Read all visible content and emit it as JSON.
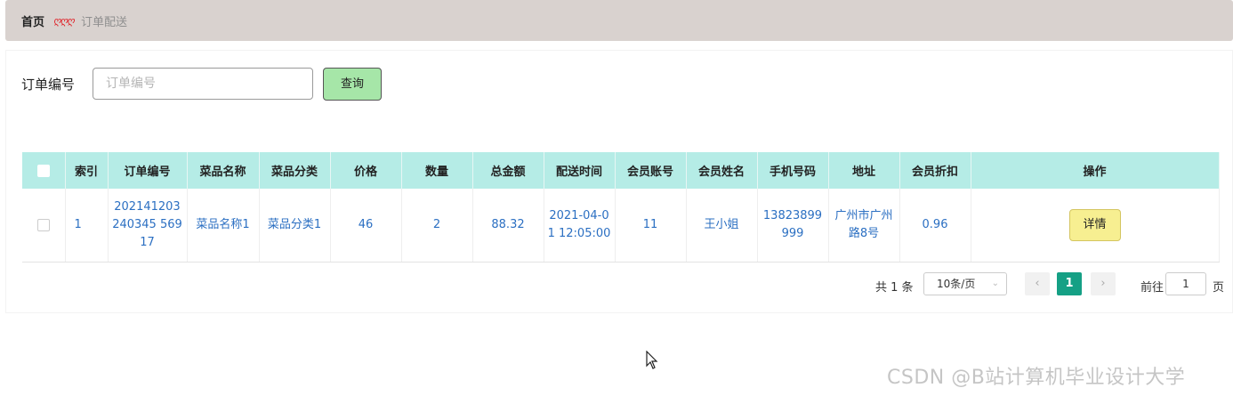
{
  "breadcrumb": {
    "home": "首页",
    "separator": "ღღღ",
    "current": "订单配送"
  },
  "search": {
    "label": "订单编号",
    "placeholder": "订单编号",
    "value": "",
    "button": "查询"
  },
  "table": {
    "headers": [
      "",
      "索引",
      "订单编号",
      "菜品名称",
      "菜品分类",
      "价格",
      "数量",
      "总金额",
      "配送时间",
      "会员账号",
      "会员姓名",
      "手机号码",
      "地址",
      "会员折扣",
      "操作"
    ],
    "rows": [
      {
        "index": "1",
        "order_no": "202141203240345 56917",
        "dish_name": "菜品名称1",
        "dish_category": "菜品分类1",
        "price": "46",
        "quantity": "2",
        "total": "88.32",
        "delivery_time": "2021-04-01 12:05:00",
        "member_account": "11",
        "member_name": "王小姐",
        "phone": "13823899999",
        "address": "广州市广州路8号",
        "discount": "0.96",
        "action": "详情"
      }
    ]
  },
  "pagination": {
    "total": "共 1 条",
    "page_size": "10条/页",
    "current_page": "1",
    "goto_label": "前往",
    "goto_value": "1",
    "page_unit": "页",
    "prev_icon": "chevron-left-icon",
    "next_icon": "chevron-right-icon"
  },
  "watermark": "CSDN @B站计算机毕业设计大学",
  "colors": {
    "header_bg": "#b5ece6",
    "search_button": "#a6e6a8",
    "detail_button": "#f7ef91",
    "active_page": "#15a085",
    "link": "#2b6fc2"
  }
}
